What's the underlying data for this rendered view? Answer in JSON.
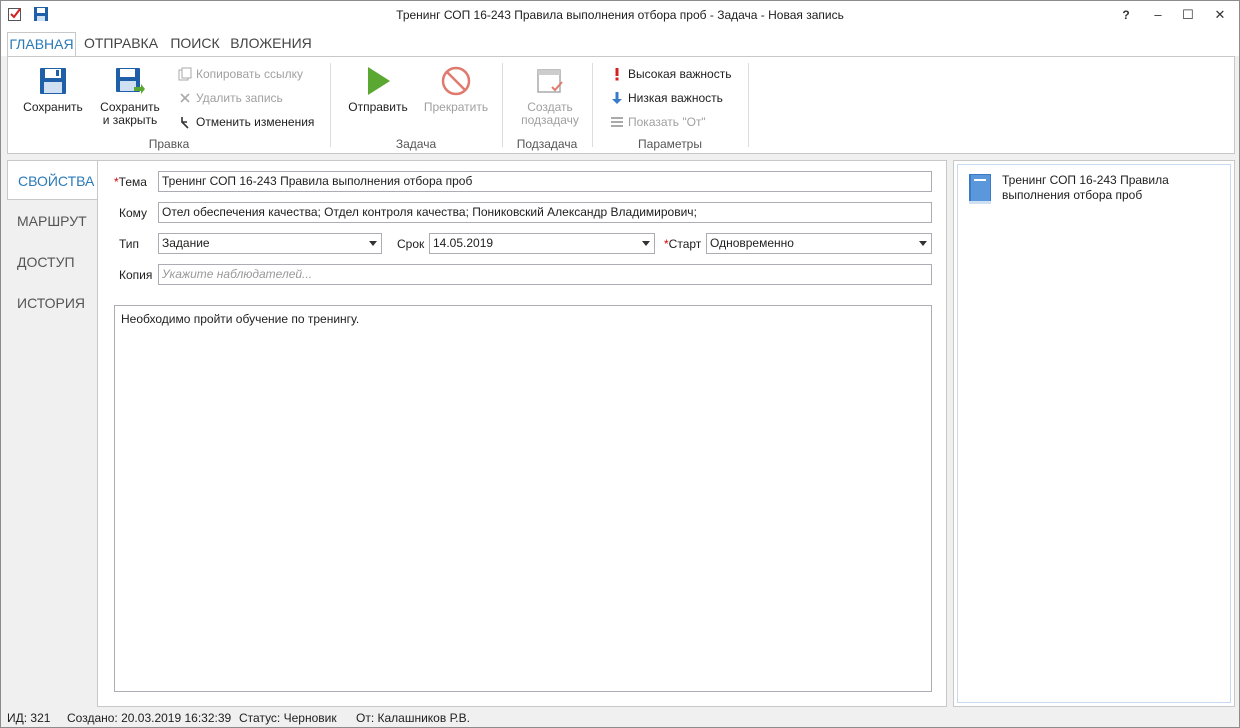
{
  "window": {
    "title": "Тренинг СОП 16-243 Правила выполнения отбора проб - Задача - Новая запись",
    "help": "?",
    "minimize": "–",
    "maximize": "☐",
    "close": "✕"
  },
  "ribbon_tabs": [
    "ГЛАВНАЯ",
    "ОТПРАВКА",
    "ПОИСК",
    "ВЛОЖЕНИЯ"
  ],
  "ribbon": {
    "edit_group": {
      "label": "Правка",
      "save": "Сохранить",
      "save_close_line1": "Сохранить",
      "save_close_line2": "и закрыть",
      "copy_link": "Копировать ссылку",
      "delete_record": "Удалить запись",
      "undo_changes": "Отменить изменения"
    },
    "task_group": {
      "label": "Задача",
      "send": "Отправить",
      "stop": "Прекратить"
    },
    "subtask_group": {
      "label": "Подзадача",
      "create_line1": "Создать",
      "create_line2": "подзадачу"
    },
    "params_group": {
      "label": "Параметры",
      "high_importance": "Высокая важность",
      "low_importance": "Низкая важность",
      "show_from": "Показать \"От\""
    }
  },
  "nav": [
    "СВОЙСТВА",
    "МАРШРУТ",
    "ДОСТУП",
    "ИСТОРИЯ"
  ],
  "form": {
    "subject_label": "Тема",
    "subject_value": "Тренинг СОП 16-243 Правила выполнения отбора проб",
    "to_label": "Кому",
    "to_value": "Отел обеспечения качества;  Отдел контроля качества;  Пониковский Александр Владимирович;",
    "type_label": "Тип",
    "type_value": "Задание",
    "due_label": "Срок",
    "due_value": "14.05.2019",
    "start_label": "Старт",
    "start_value": "Одновременно",
    "copy_label": "Копия",
    "copy_placeholder": "Укажите наблюдателей...",
    "required_mark": "*",
    "body": "Необходимо пройти обучение по тренингу."
  },
  "attachment": {
    "name": "Тренинг СОП 16-243 Правила выполнения отбора проб"
  },
  "status": {
    "id": "ИД: 321",
    "created": "Создано: 20.03.2019 16:32:39",
    "state": "Статус: Черновик",
    "from": "От: Калашников Р.В."
  },
  "colors": {
    "accent": "#2a7ab8",
    "save_blue": "#1f5fa8",
    "send_green": "#5aa832",
    "stop_red": "#e07a6e",
    "important_red": "#d42020",
    "low_blue": "#3a7bc8"
  }
}
